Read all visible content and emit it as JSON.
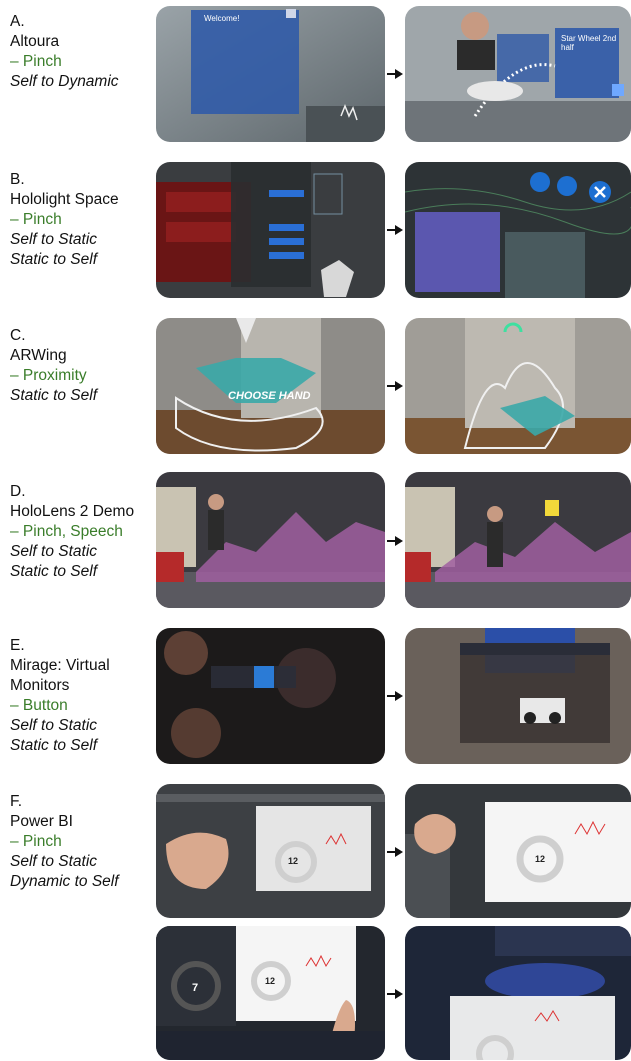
{
  "rows": [
    {
      "letter": "A.",
      "title": [
        "Altoura"
      ],
      "methods": "– Pinch",
      "transitions": [
        "Self to Dynamic"
      ]
    },
    {
      "letter": "B.",
      "title": [
        "Hololight Space"
      ],
      "methods": "– Pinch",
      "transitions": [
        "Self to Static",
        "Static to Self"
      ]
    },
    {
      "letter": "C.",
      "title": [
        "ARWing"
      ],
      "methods": "– Proximity",
      "transitions": [
        "Static to Self"
      ]
    },
    {
      "letter": "D.",
      "title": [
        "HoloLens 2 Demo"
      ],
      "methods": "– Pinch, Speech",
      "transitions": [
        "Self to Static",
        "Static to Self"
      ]
    },
    {
      "letter": "E.",
      "title": [
        "Mirage: Virtual",
        "Monitors"
      ],
      "methods": "– Button",
      "transitions": [
        "Self to Static",
        "Static to Self"
      ]
    },
    {
      "letter": "F.",
      "title": [
        "Power BI"
      ],
      "methods": "– Pinch",
      "transitions": [
        "Self to Static",
        "Dynamic to Self"
      ]
    }
  ],
  "overlays": {
    "a_welcome": "Welcome!",
    "a_card": "Star Wheel 2nd half",
    "c_choose": "CHOOSE HAND",
    "f_num1": "12",
    "f_num2": "12",
    "f_num3": "7",
    "f_num4": "12"
  }
}
